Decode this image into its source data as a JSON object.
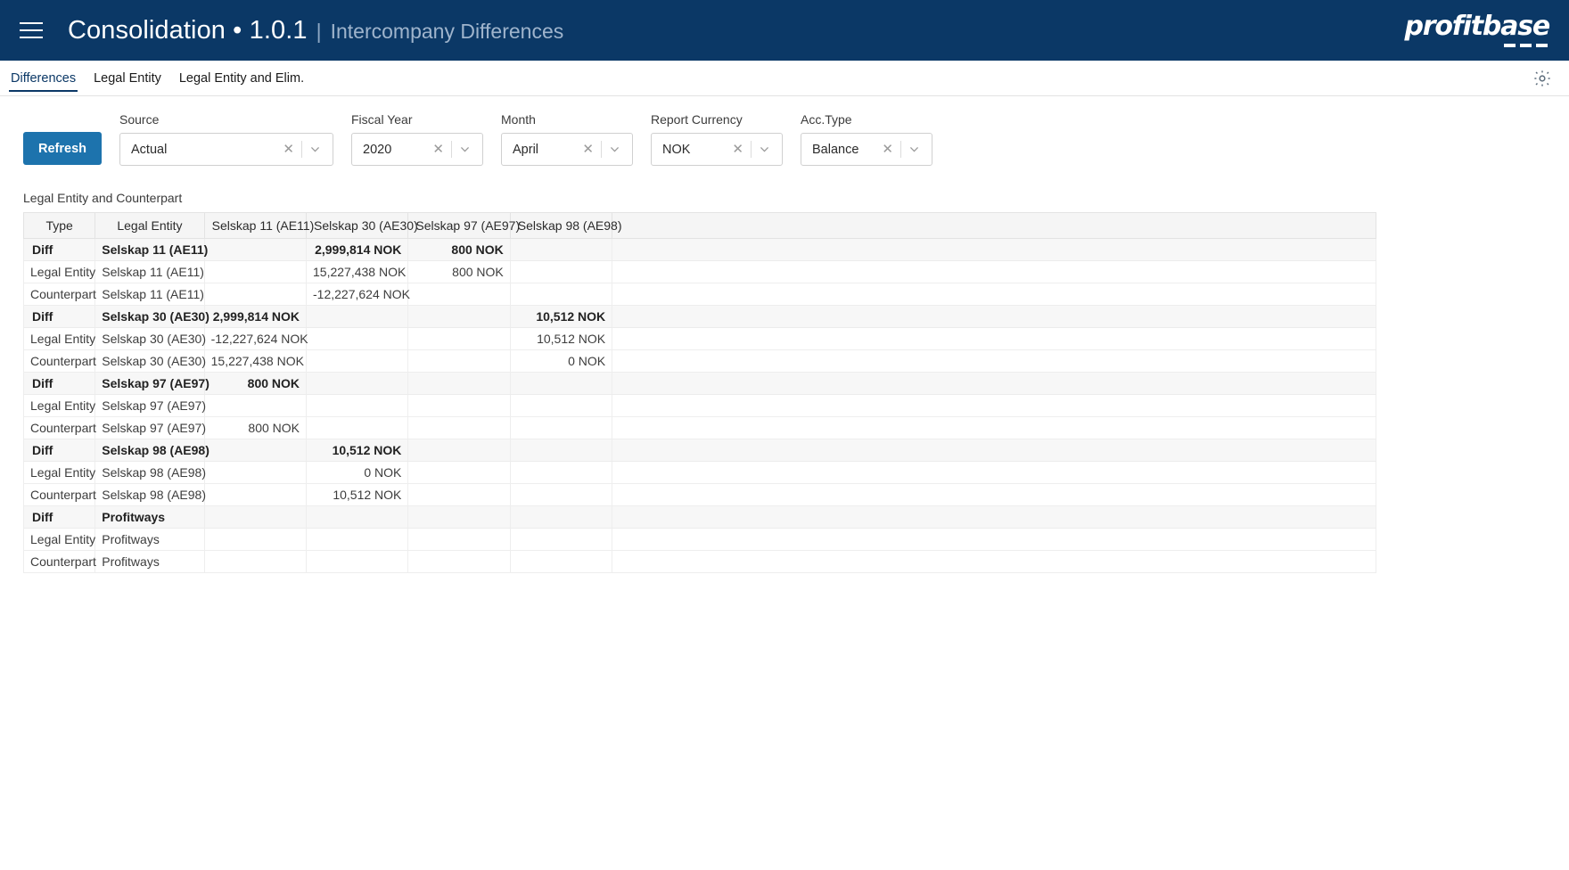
{
  "appbar": {
    "menu_icon": "hamburger-icon",
    "title_main": "Consolidation • 1.0.1",
    "title_separator": "|",
    "title_sub": "Intercompany Differences",
    "logo_text": "profitbase",
    "brand_color": "#0b3866"
  },
  "tabs": [
    {
      "label": "Differences",
      "active": true
    },
    {
      "label": "Legal Entity",
      "active": false
    },
    {
      "label": "Legal Entity and Elim.",
      "active": false
    }
  ],
  "tabbar": {
    "settings_icon": "gear-icon"
  },
  "toolbar": {
    "refresh_label": "Refresh",
    "refresh_color": "#1d73ad"
  },
  "filters": [
    {
      "label": "Source",
      "value": "Actual",
      "clear": "✕",
      "caret": "chevron-down-icon"
    },
    {
      "label": "Fiscal Year",
      "value": "2020",
      "clear": "✕",
      "caret": "chevron-down-icon"
    },
    {
      "label": "Month",
      "value": "April",
      "clear": "✕",
      "caret": "chevron-down-icon"
    },
    {
      "label": "Report Currency",
      "value": "NOK",
      "clear": "✕",
      "caret": "chevron-down-icon"
    },
    {
      "label": "Acc.Type",
      "value": "Balance",
      "clear": "✕",
      "caret": "chevron-down-icon"
    }
  ],
  "grid": {
    "title": "Legal Entity and Counterpart",
    "columns": [
      "Type",
      "Legal Entity",
      "Selskap 11 (AE11)",
      "Selskap 30 (AE30)",
      "Selskap 97 (AE97)",
      "Selskap 98 (AE98)",
      ""
    ],
    "rows": [
      {
        "type": "Diff",
        "entity": "Selskap 11 (AE11)",
        "values": [
          "",
          "2,999,814 NOK",
          "800 NOK",
          ""
        ],
        "is_diff": true
      },
      {
        "type": "Legal Entity",
        "entity": "Selskap 11 (AE11)",
        "values": [
          "",
          "15,227,438 NOK",
          "800 NOK",
          ""
        ],
        "is_diff": false
      },
      {
        "type": "Counterpart",
        "entity": "Selskap 11 (AE11)",
        "values": [
          "",
          "-12,227,624 NOK",
          "",
          ""
        ],
        "is_diff": false
      },
      {
        "type": "Diff",
        "entity": "Selskap 30 (AE30)",
        "values": [
          "2,999,814 NOK",
          "",
          "",
          "10,512 NOK"
        ],
        "is_diff": true
      },
      {
        "type": "Legal Entity",
        "entity": "Selskap 30 (AE30)",
        "values": [
          "-12,227,624 NOK",
          "",
          "",
          "10,512 NOK"
        ],
        "is_diff": false
      },
      {
        "type": "Counterpart",
        "entity": "Selskap 30 (AE30)",
        "values": [
          "15,227,438 NOK",
          "",
          "",
          "0 NOK"
        ],
        "is_diff": false
      },
      {
        "type": "Diff",
        "entity": "Selskap 97 (AE97)",
        "values": [
          "800 NOK",
          "",
          "",
          ""
        ],
        "is_diff": true
      },
      {
        "type": "Legal Entity",
        "entity": "Selskap 97 (AE97)",
        "values": [
          "",
          "",
          "",
          ""
        ],
        "is_diff": false
      },
      {
        "type": "Counterpart",
        "entity": "Selskap 97 (AE97)",
        "values": [
          "800 NOK",
          "",
          "",
          ""
        ],
        "is_diff": false
      },
      {
        "type": "Diff",
        "entity": "Selskap 98 (AE98)",
        "values": [
          "",
          "10,512 NOK",
          "",
          ""
        ],
        "is_diff": true
      },
      {
        "type": "Legal Entity",
        "entity": "Selskap 98 (AE98)",
        "values": [
          "",
          "0 NOK",
          "",
          ""
        ],
        "is_diff": false
      },
      {
        "type": "Counterpart",
        "entity": "Selskap 98 (AE98)",
        "values": [
          "",
          "10,512 NOK",
          "",
          ""
        ],
        "is_diff": false
      },
      {
        "type": "Diff",
        "entity": "Profitways",
        "values": [
          "",
          "",
          "",
          ""
        ],
        "is_diff": true
      },
      {
        "type": "Legal Entity",
        "entity": "Profitways",
        "values": [
          "",
          "",
          "",
          ""
        ],
        "is_diff": false
      },
      {
        "type": "Counterpart",
        "entity": "Profitways",
        "values": [
          "",
          "",
          "",
          ""
        ],
        "is_diff": false
      }
    ]
  }
}
